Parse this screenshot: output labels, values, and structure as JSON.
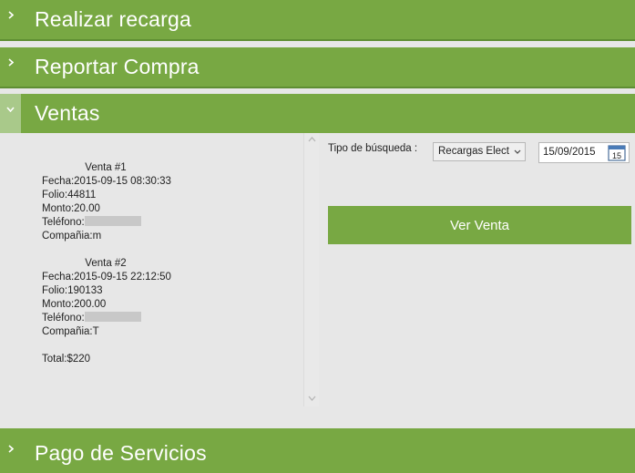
{
  "accordion": {
    "recarga": {
      "title": "Realizar recarga",
      "expanded": false
    },
    "compra": {
      "title": "Reportar Compra",
      "expanded": false
    },
    "ventas": {
      "title": "Ventas",
      "expanded": true
    },
    "servicios": {
      "title": "Pago de Servicios",
      "expanded": false
    }
  },
  "ventas": {
    "sales": [
      {
        "header": "Venta #1",
        "fecha": "Fecha:2015-09-15 08:30:33",
        "folio": "Folio:44811",
        "monto": "Monto:20.00",
        "telefono_label": "Teléfono:",
        "compania": "Compañia:m"
      },
      {
        "header": "Venta #2",
        "fecha": "Fecha:2015-09-15 22:12:50",
        "folio": "Folio:190133",
        "monto": "Monto:200.00",
        "telefono_label": "Teléfono:",
        "compania": "Compañia:T"
      }
    ],
    "total": "Total:$220",
    "search": {
      "label": "Tipo de búsqueda :",
      "type_selected": "Recargas Elect",
      "date": "15/09/2015",
      "calendar_day": "15"
    },
    "ver_venta_label": "Ver Venta"
  },
  "colors": {
    "accent": "#78a843",
    "background": "#e7e7e7"
  },
  "icons": {
    "collapsed": "chevron-right-icon",
    "expanded": "chevron-down-icon",
    "calendar": "calendar-icon"
  }
}
